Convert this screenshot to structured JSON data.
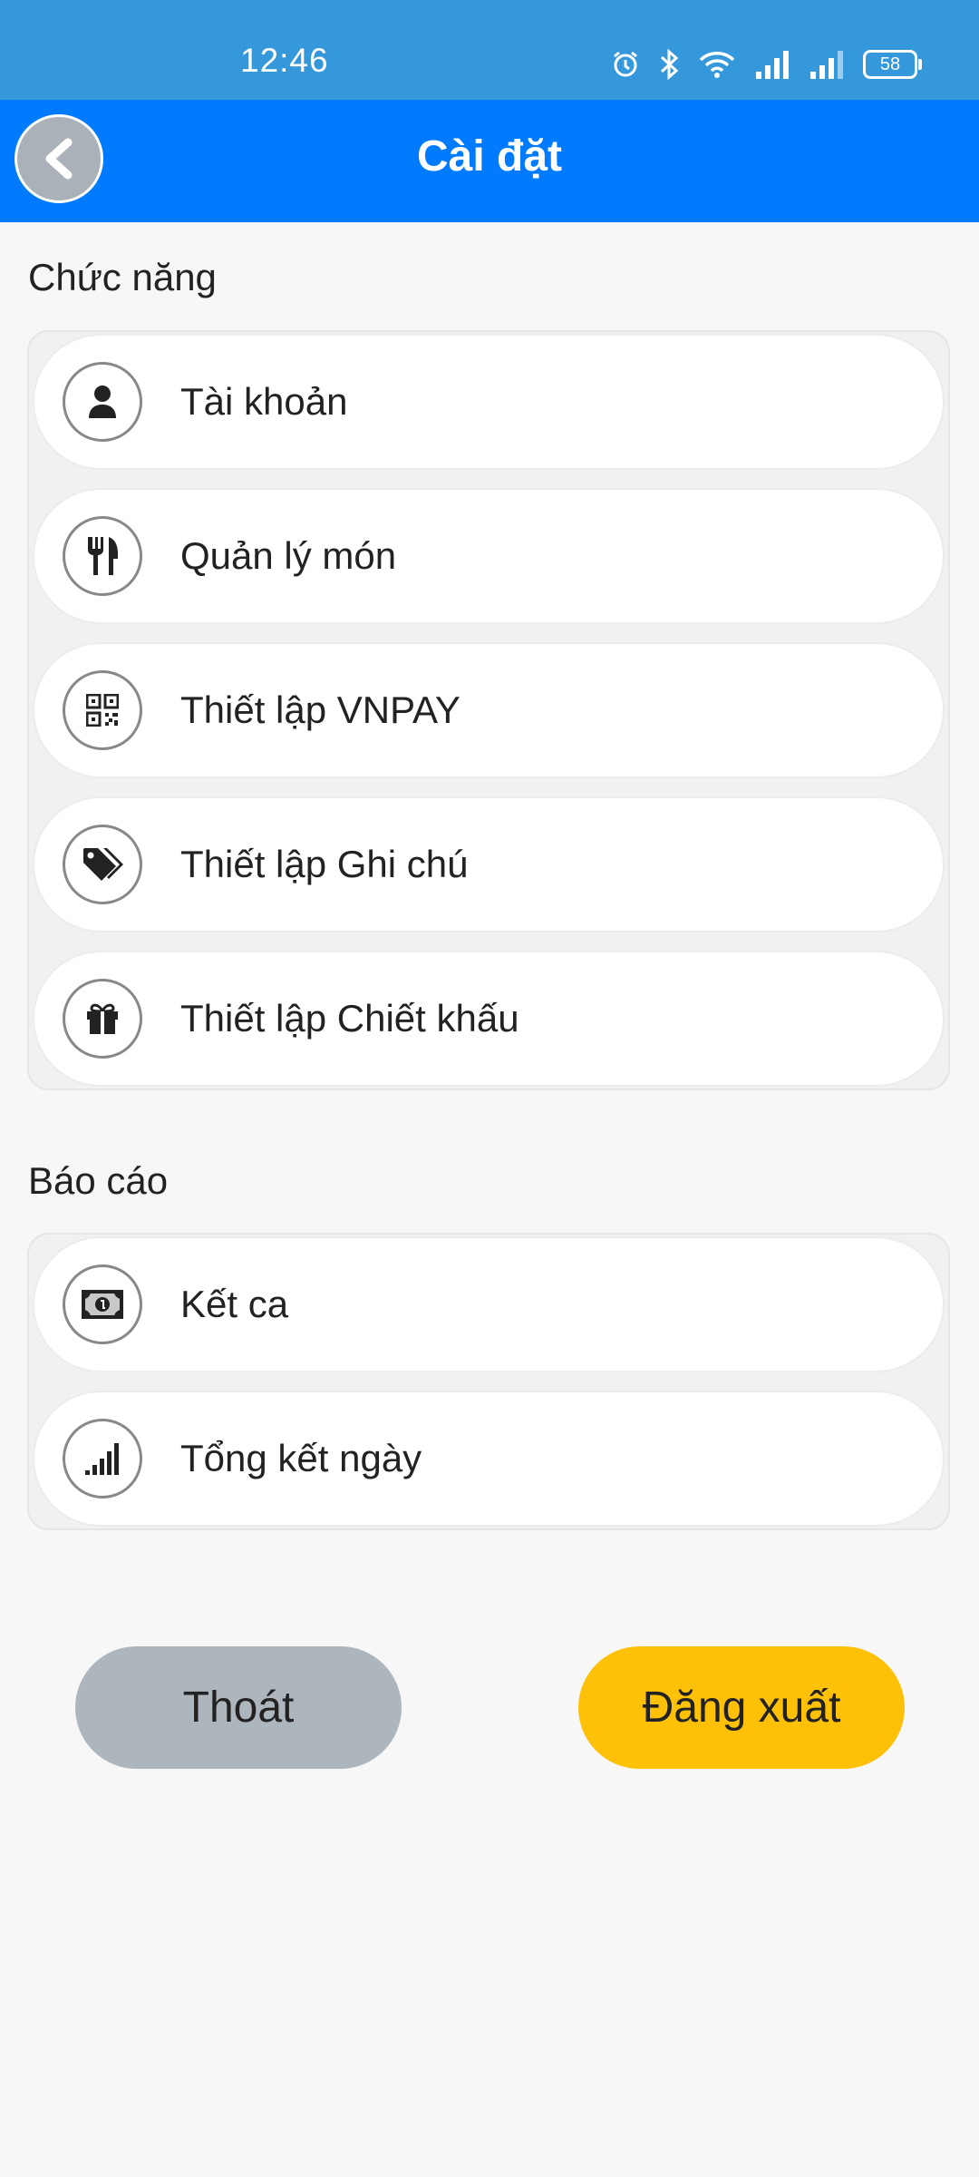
{
  "status_bar": {
    "time": "12:46",
    "battery": "58"
  },
  "header": {
    "title": "Cài đặt"
  },
  "sections": {
    "functions": {
      "title": "Chức năng",
      "items": [
        {
          "label": "Tài khoản",
          "icon": "user-icon"
        },
        {
          "label": "Quản lý món",
          "icon": "utensils-icon"
        },
        {
          "label": "Thiết lập VNPAY",
          "icon": "qrcode-icon"
        },
        {
          "label": "Thiết lập Ghi chú",
          "icon": "tags-icon"
        },
        {
          "label": "Thiết lập Chiết khấu",
          "icon": "gift-icon"
        }
      ]
    },
    "reports": {
      "title": "Báo cáo",
      "items": [
        {
          "label": "Kết ca",
          "icon": "money-bill-icon"
        },
        {
          "label": "Tổng kết ngày",
          "icon": "signal-bars-icon"
        }
      ]
    }
  },
  "buttons": {
    "exit": "Thoát",
    "logout": "Đăng xuất"
  },
  "colors": {
    "status_bar": "#3498db",
    "app_bar": "#007bff",
    "exit_button": "#adb5bd",
    "logout_button": "#ffc107",
    "background": "#f7f7f7"
  }
}
